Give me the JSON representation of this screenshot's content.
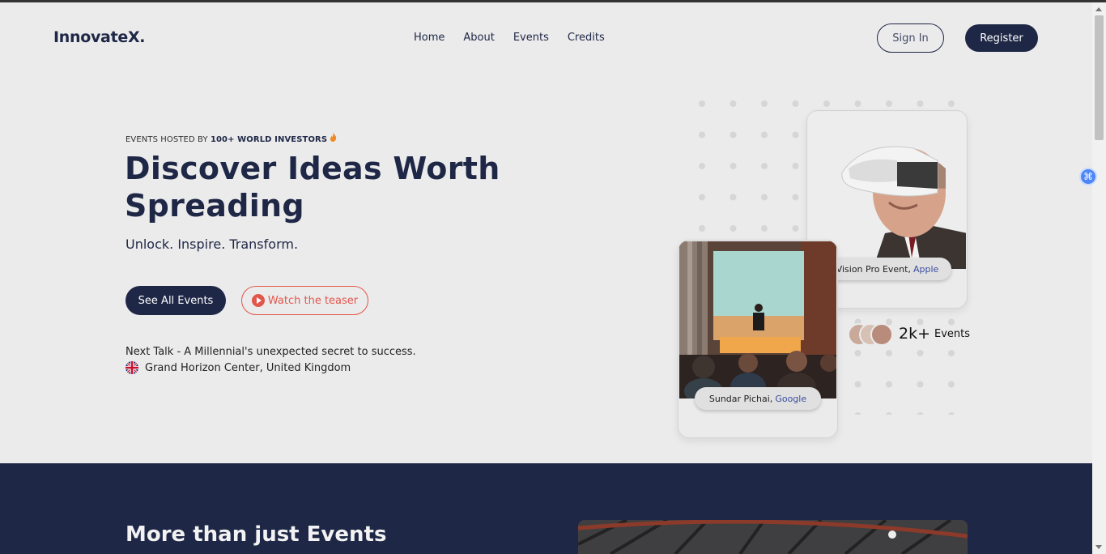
{
  "header": {
    "logo": "InnovateX.",
    "nav": [
      "Home",
      "About",
      "Events",
      "Credits"
    ],
    "sign_in": "Sign In",
    "register": "Register"
  },
  "hero": {
    "eyebrow_prefix": "EVENTS HOSTED BY ",
    "eyebrow_bold": "100+ WORLD INVESTORS",
    "headline": "Discover Ideas Worth Spreading",
    "tagline": "Unlock. Inspire. Transform.",
    "primary_cta": "See All Events",
    "secondary_cta": "Watch the teaser",
    "next_talk": "Next Talk - A Millennial's unexpected secret to success.",
    "location": "Grand Horizon Center, United Kingdom"
  },
  "cards": {
    "top": {
      "person": "Vision Pro Event,",
      "company": "Apple"
    },
    "bottom": {
      "person": "Sundar Pichai,",
      "company": "Google"
    }
  },
  "stat": {
    "number": "2k+",
    "label": "Events"
  },
  "section2": {
    "title": "More than just Events"
  },
  "colors": {
    "navy": "#1e2746",
    "accent_red": "#e2574c",
    "link_blue": "#3a4da0",
    "background": "#ebebeb"
  },
  "icons": [
    "flame-icon",
    "play-icon",
    "uk-flag-icon",
    "extension-icon"
  ]
}
